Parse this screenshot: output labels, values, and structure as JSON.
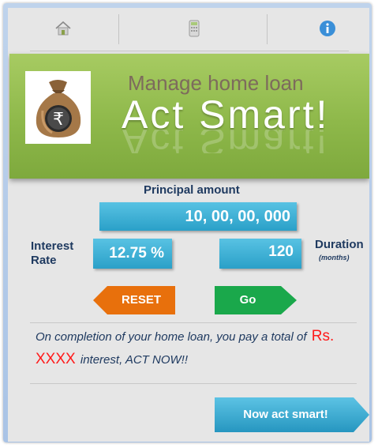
{
  "tabs": [
    {
      "name": "home",
      "icon": "home-icon"
    },
    {
      "name": "calculator",
      "icon": "calculator-icon"
    },
    {
      "name": "info",
      "icon": "info-icon"
    }
  ],
  "banner": {
    "subtitle": "Manage home loan",
    "title": "Act Smart!",
    "logo": "money-bag-rupee-icon"
  },
  "form": {
    "principal_label": "Principal amount",
    "principal_value": "10, 00, 00, 000",
    "interest_label_line1": "Interest",
    "interest_label_line2": "Rate",
    "interest_value": "12.75 %",
    "duration_label": "Duration",
    "duration_unit": "(months)",
    "duration_value": "120"
  },
  "buttons": {
    "reset": "RESET",
    "go": "Go",
    "act": "Now act smart!"
  },
  "message": {
    "part1": "On completion of your home loan, you pay a total of",
    "amount": "Rs. XXXX",
    "part2": "interest, ACT NOW!!"
  },
  "colors": {
    "banner_green": "#8eb84a",
    "input_blue": "#2aa0c8",
    "reset_orange": "#e8700c",
    "go_green": "#1aa84b",
    "highlight_red": "#ff1a1a",
    "label_navy": "#1f3a60"
  }
}
